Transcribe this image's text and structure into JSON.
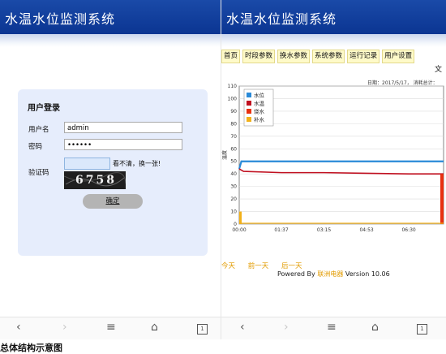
{
  "app_title": "水温水位监测系统",
  "login": {
    "heading": "用户登录",
    "username_label": "用户名",
    "username_value": "admin",
    "password_label": "密码",
    "password_value": "••••••",
    "captcha_label": "验证码",
    "captcha_refresh": "看不清，换一张!",
    "captcha_code": "6758",
    "submit_label": "确定"
  },
  "tabs": [
    {
      "label": "首页"
    },
    {
      "label": "时段参数"
    },
    {
      "label": "换水参数"
    },
    {
      "label": "系统参数"
    },
    {
      "label": "运行记录"
    },
    {
      "label": "用户设置"
    }
  ],
  "corner_glyph": "文",
  "date_info": "日期：2017/5/17，  消耗总计：",
  "chart_data": {
    "type": "line",
    "ylabel": "温度",
    "ylim": [
      0,
      110
    ],
    "yticks": [
      0,
      10,
      20,
      30,
      40,
      50,
      60,
      70,
      80,
      90,
      100,
      110
    ],
    "xticks": [
      "00:00",
      "01:37",
      "03:15",
      "04:53",
      "06:30"
    ],
    "x": [
      "00:00",
      "00:05",
      "00:10",
      "01:37",
      "03:15",
      "04:53",
      "06:30",
      "07:50"
    ],
    "series": [
      {
        "name": "水位",
        "color": "#2a8ad8",
        "values": [
          44,
          50,
          50,
          50,
          50,
          50,
          50,
          50
        ]
      },
      {
        "name": "水温",
        "color": "#c01020",
        "values": [
          44,
          43,
          42,
          41,
          41,
          40.5,
          40,
          40
        ]
      },
      {
        "name": "烧水",
        "color": "#e83010",
        "values": [
          0,
          0,
          0,
          0,
          0,
          0,
          0,
          40
        ]
      },
      {
        "name": "补水",
        "color": "#f2b11a",
        "values": [
          10,
          0,
          0,
          0,
          0,
          0,
          0,
          0
        ]
      }
    ]
  },
  "links": {
    "today": "今天",
    "prev": "前一天",
    "next": "后一天"
  },
  "footer": {
    "prefix": "Powered By ",
    "brand": "联洲电器",
    "version": " Version 10.06"
  },
  "nav": {
    "back": "‹",
    "forward": "›",
    "menu": "≡",
    "home": "⌂",
    "tab_count": "1"
  },
  "caption": "总体结构示意图"
}
